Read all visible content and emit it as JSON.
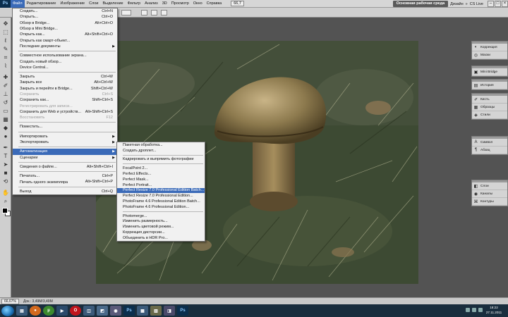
{
  "menubar": {
    "logo": "Ps",
    "items": [
      "Файл",
      "Редактирование",
      "Изображение",
      "Слои",
      "Выделение",
      "Фильтр",
      "Анализ",
      "3D",
      "Просмотр",
      "Окно",
      "Справка"
    ],
    "zoom": "66,7",
    "workspace_active": "Основная рабочая среда",
    "workspace_other": "Дизайн",
    "cs_live": "CS Live"
  },
  "file_menu": {
    "items": [
      {
        "label": "Создать...",
        "shortcut": "Ctrl+N"
      },
      {
        "label": "Открыть...",
        "shortcut": "Ctrl+O"
      },
      {
        "label": "Обзор в Bridge...",
        "shortcut": "Alt+Ctrl+O"
      },
      {
        "label": "Обзор в Mini Bridge...",
        "shortcut": ""
      },
      {
        "label": "Открыть как...",
        "shortcut": "Alt+Shift+Ctrl+O"
      },
      {
        "label": "Открыть как смарт-объект...",
        "shortcut": ""
      },
      {
        "label": "Последние документы",
        "shortcut": ""
      },
      {
        "label": "Совместное использование экрана...",
        "shortcut": ""
      },
      {
        "label": "Создать новый обзор...",
        "shortcut": ""
      },
      {
        "label": "Device Central...",
        "shortcut": ""
      },
      {
        "label": "Закрыть",
        "shortcut": "Ctrl+W"
      },
      {
        "label": "Закрыть все",
        "shortcut": "Alt+Ctrl+W"
      },
      {
        "label": "Закрыть и перейти в Bridge...",
        "shortcut": "Shift+Ctrl+W"
      },
      {
        "label": "Сохранить",
        "shortcut": "Ctrl+S"
      },
      {
        "label": "Сохранить как...",
        "shortcut": "Shift+Ctrl+S"
      },
      {
        "label": "Регистрировать для записи...",
        "shortcut": ""
      },
      {
        "label": "Сохранить для Web и устройств...",
        "shortcut": "Alt+Shift+Ctrl+S"
      },
      {
        "label": "Восстановить",
        "shortcut": "F12"
      },
      {
        "label": "Поместить...",
        "shortcut": ""
      },
      {
        "label": "Импортировать",
        "shortcut": ""
      },
      {
        "label": "Экспортировать",
        "shortcut": ""
      },
      {
        "label": "Автоматизация",
        "shortcut": ""
      },
      {
        "label": "Сценарии",
        "shortcut": ""
      },
      {
        "label": "Сведения о файле...",
        "shortcut": "Alt+Shift+Ctrl+I"
      },
      {
        "label": "Печатать...",
        "shortcut": "Ctrl+P"
      },
      {
        "label": "Печать одного экземпляра",
        "shortcut": "Alt+Shift+Ctrl+P"
      },
      {
        "label": "Выход",
        "shortcut": "Ctrl+Q"
      }
    ]
  },
  "automation_submenu": {
    "items": [
      "Пакетная обработка...",
      "Создать дроплет...",
      "Кадрировать и выпрямить фотографии",
      "FocalPoint 2...",
      "Perfect Effects...",
      "Perfect Mask...",
      "Perfect Portrait...",
      "Perfect Resize 7.0 Professional Edition Batch...",
      "Perfect Resize 7.0 Professional Edition...",
      "PhotoFrame 4.6 Professional Edition Batch...",
      "PhotoFrame 4.6 Professional Edition...",
      "Photomerge...",
      "Изменить размерность...",
      "Изменить цветовой режим...",
      "Коррекция дисторсии...",
      "Объединить в HDR Pro..."
    ]
  },
  "dock": {
    "group1": [
      "Коррекция",
      "Маски"
    ],
    "group2": [
      "Mini Bridge"
    ],
    "group3": [
      "История"
    ],
    "group4": [
      "Кисть",
      "Образцы",
      "Стили"
    ],
    "group5": [
      "Символ",
      "Абзац"
    ],
    "group6": [
      "Слои",
      "Каналы",
      "Контуры"
    ]
  },
  "status": {
    "zoom": "66,67%",
    "doc": "Док.: 3,49M/3,49M"
  },
  "taskbar": {
    "time": "18:22",
    "date": "27.11.2011"
  },
  "colors": {
    "highlight": "#3a6ab8",
    "workspace_bg": "#535353",
    "taskbar": "#1a2e3e"
  }
}
